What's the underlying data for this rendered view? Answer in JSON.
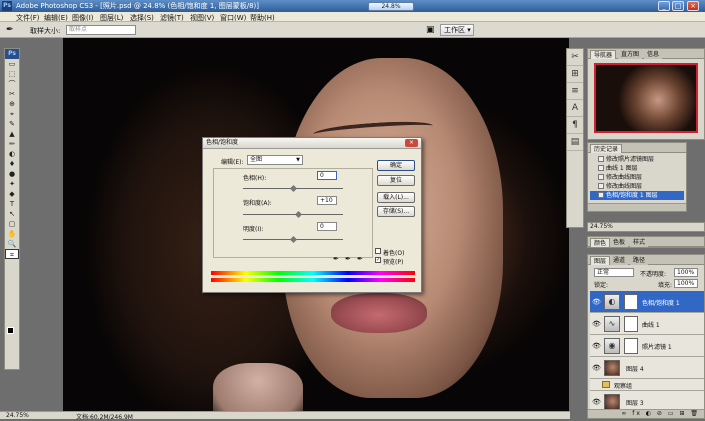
{
  "window": {
    "title": "Adobe Photoshop CS3 - [照片.psd @ 24.8% (色相/饱和度 1, 图层蒙板/8)]",
    "zoom_indicator": "24.8%",
    "min": "_",
    "max": "□",
    "close": "×"
  },
  "menu": [
    "文件(F)",
    "编辑(E)",
    "图像(I)",
    "图层(L)",
    "选择(S)",
    "滤镜(T)",
    "视图(V)",
    "窗口(W)",
    "帮助(H)"
  ],
  "options": {
    "sample_size_label": "取样大小:",
    "sample_size_value": "取样点",
    "workspace": "工作区 ▾"
  },
  "toolbox": {
    "logo": "Ps",
    "tools": [
      "▭",
      "⬚",
      "⌒",
      "✂",
      "⊕",
      "⌖",
      "✎",
      "▲",
      "✏",
      "◐",
      "♦",
      "●",
      "✦",
      "◆",
      "T",
      "↖",
      "▢",
      "✋",
      "🔍",
      "⌗"
    ]
  },
  "status": {
    "zoom": "24.75%",
    "doc": "文档:60.2M/246.9M"
  },
  "ministrip": [
    "✂",
    "⊞",
    "≡",
    "A",
    "¶",
    "▤"
  ],
  "nav_panel": {
    "tabs": [
      "导航器",
      "直方图",
      "信息"
    ]
  },
  "history_panel": {
    "tab": "历史记录",
    "items": [
      "修改照片滤镜图层",
      "曲线 1 图层",
      "修改曲线图层",
      "修改曲线图层",
      "色相/饱和度 1 图层"
    ],
    "zoom": "24.75%"
  },
  "color_panel": {
    "tabs": [
      "颜色",
      "色板",
      "样式"
    ]
  },
  "layers_panel": {
    "tabs": [
      "图层",
      "通道",
      "路径"
    ],
    "blend_mode": "正常",
    "opacity_label": "不透明度:",
    "opacity": "100%",
    "lock_label": "锁定:",
    "fill_label": "填充:",
    "fill": "100%",
    "layers": [
      {
        "name": "色相/饱和度 1",
        "selected": true
      },
      {
        "name": "曲线 1",
        "selected": false
      },
      {
        "name": "照片滤镜 1",
        "selected": false
      },
      {
        "name": "图层 4",
        "selected": false
      },
      {
        "name": "观察组",
        "selected": false
      },
      {
        "name": "图层 3",
        "selected": false
      },
      {
        "name": "背景",
        "selected": false
      }
    ],
    "footer": "∞ fx ◐ ⊘ ▭ ⊞ 🗑"
  },
  "dialog": {
    "title": "色相/饱和度",
    "close": "×",
    "edit_label": "编辑(E):",
    "edit_value": "全图",
    "hue_label": "色相(H):",
    "hue_value": "0",
    "hue": 0,
    "saturation_label": "饱和度(A):",
    "saturation_value": "+10",
    "saturation": 10,
    "lightness_label": "明度(I):",
    "lightness_value": "0",
    "lightness": 0,
    "ok": "确定",
    "reset": "复位",
    "load": "载入(L)...",
    "save": "存储(S)...",
    "colorize_label": "着色(O)",
    "colorize_checked": false,
    "preview_label": "预览(P)",
    "preview_checked": true
  }
}
